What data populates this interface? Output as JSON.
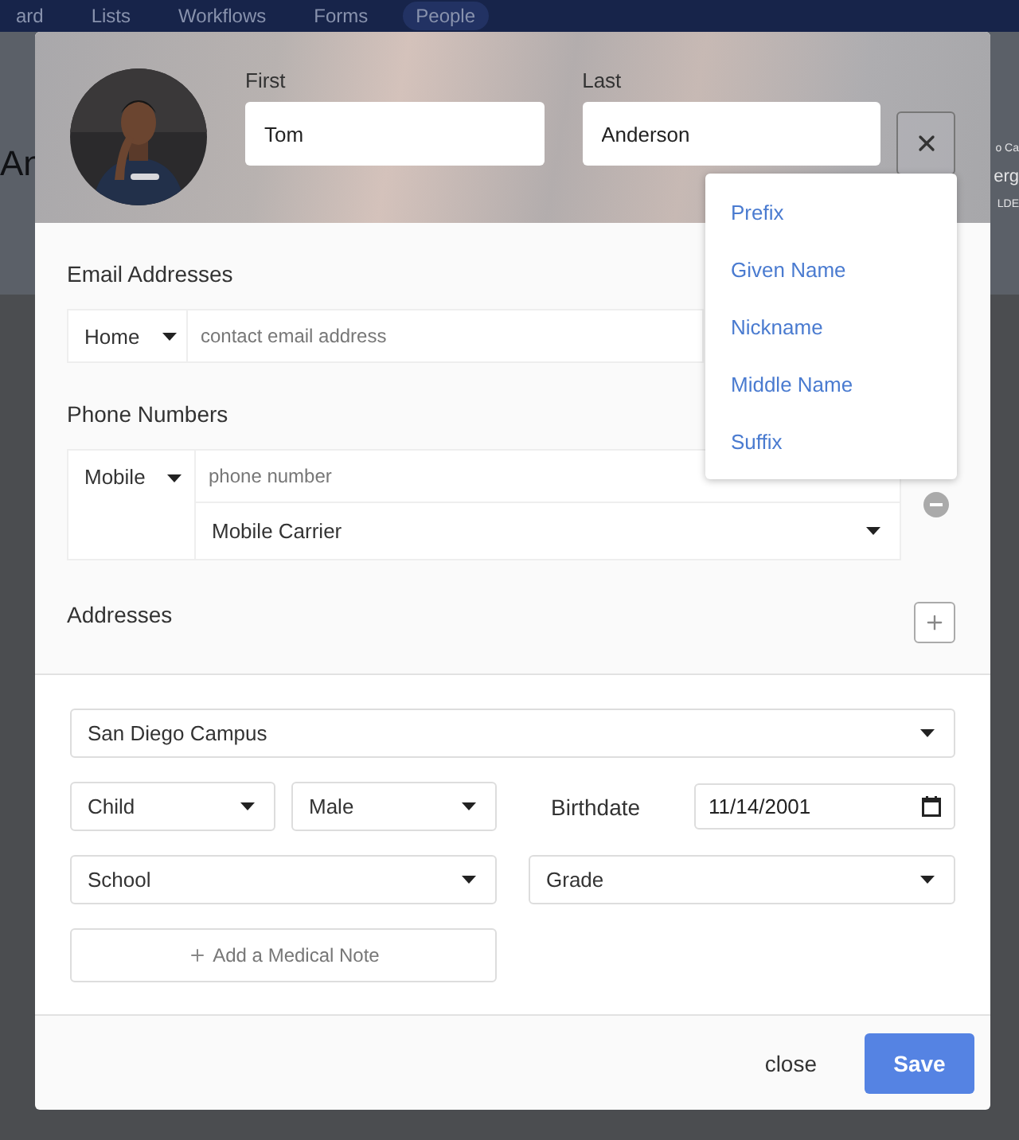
{
  "background": {
    "nav": [
      {
        "label": "ard",
        "selected": false
      },
      {
        "label": "Lists",
        "selected": false
      },
      {
        "label": "Workflows",
        "selected": false
      },
      {
        "label": "Forms",
        "selected": false
      },
      {
        "label": "People",
        "selected": true
      }
    ],
    "heading_fragment": "An",
    "right_fragments": [
      "o Ca",
      "erg",
      "LDE"
    ]
  },
  "modal": {
    "first": {
      "label": "First",
      "value": "Tom"
    },
    "last": {
      "label": "Last",
      "value": "Anderson"
    },
    "name_menu": [
      "Prefix",
      "Given Name",
      "Nickname",
      "Middle Name",
      "Suffix"
    ],
    "emails": {
      "title": "Email Addresses",
      "rows": [
        {
          "type": "Home",
          "placeholder": "contact email address"
        }
      ]
    },
    "phones": {
      "title": "Phone Numbers",
      "rows": [
        {
          "type": "Mobile",
          "placeholder": "phone number",
          "carrier": "Mobile Carrier"
        }
      ]
    },
    "addresses": {
      "title": "Addresses"
    },
    "campus": "San Diego Campus",
    "role": "Child",
    "gender": "Male",
    "birthdate": {
      "label": "Birthdate",
      "value": "11/14/2001"
    },
    "school": "School",
    "grade": "Grade",
    "medical_note": "Add a Medical Note",
    "footer": {
      "close": "close",
      "save": "Save"
    }
  }
}
